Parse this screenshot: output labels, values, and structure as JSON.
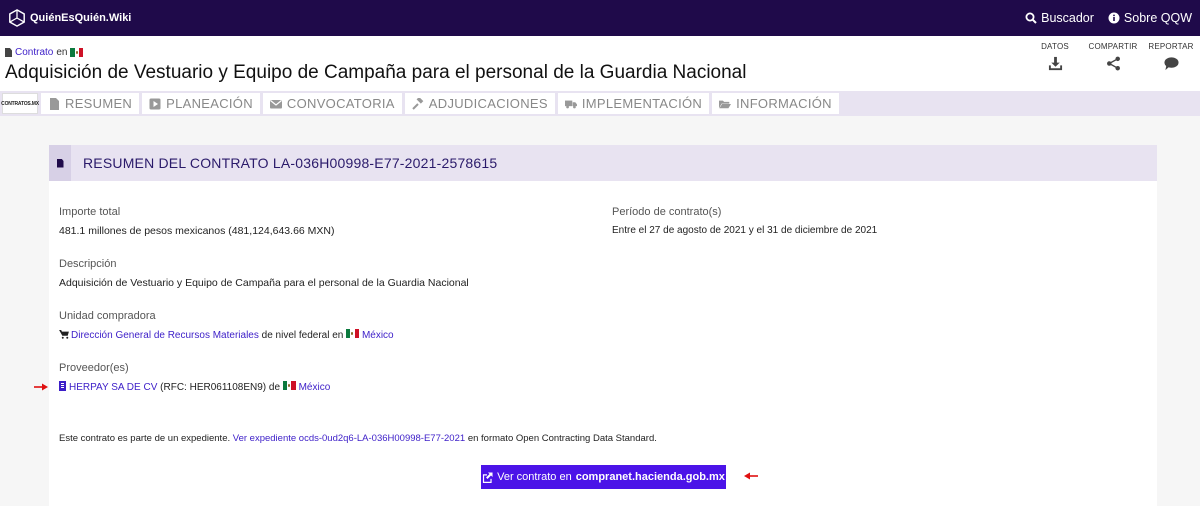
{
  "topbar": {
    "brand": "QuiénEsQuién.Wiki",
    "nav": [
      {
        "label": "Buscador",
        "icon": "search-icon"
      },
      {
        "label": "Sobre QQW",
        "icon": "info-icon"
      }
    ]
  },
  "header": {
    "breadcrumb_link": "Contrato",
    "breadcrumb_suffix": "en",
    "title": "Adquisición de Vestuario y Equipo de Campaña para el personal de la Guardia Nacional",
    "actions": [
      {
        "label": "DATOS",
        "icon": "download-icon"
      },
      {
        "label": "COMPARTIR",
        "icon": "share-icon"
      },
      {
        "label": "REPORTAR",
        "icon": "comment-icon"
      }
    ]
  },
  "tabs": {
    "logo": "CONTRATOS.MX",
    "items": [
      {
        "label": "RESUMEN",
        "icon": "file-icon"
      },
      {
        "label": "PLANEACIÓN",
        "icon": "play-icon"
      },
      {
        "label": "CONVOCATORIA",
        "icon": "envelope-icon"
      },
      {
        "label": "ADJUDICACIONES",
        "icon": "gavel-icon"
      },
      {
        "label": "IMPLEMENTACIÓN",
        "icon": "truck-icon"
      },
      {
        "label": "INFORMACIÓN",
        "icon": "folder-icon"
      }
    ]
  },
  "summary": {
    "heading": "RESUMEN DEL CONTRATO LA-036H00998-E77-2021-2578615",
    "importe_label": "Importe total",
    "importe_value": "481.1 millones de pesos mexicanos (481,124,643.66 MXN)",
    "periodo_label": "Período de contrato(s)",
    "periodo_value": "Entre el 27 de agosto de 2021 y el 31 de diciembre de 2021",
    "descripcion_label": "Descripción",
    "descripcion_value": "Adquisición de Vestuario y Equipo de Campaña para el personal de la Guardia Nacional",
    "unidad_label": "Unidad compradora",
    "unidad_link": "Dirección General de Recursos Materiales",
    "unidad_middle": "de nivel federal en",
    "unidad_country": "México",
    "proveedor_label": "Proveedor(es)",
    "proveedor_link": "HERPAY SA DE CV",
    "proveedor_rfc": "(RFC: HER061108EN9) de",
    "proveedor_country": "México",
    "expediente_prefix": "Este contrato es parte de un expediente.",
    "expediente_link": "Ver expediente ocds-0ud2q6-LA-036H00998-E77-2021",
    "expediente_suffix": "en formato Open Contracting Data Standard.",
    "button_prefix": "Ver contrato en",
    "button_bold": "compranet.hacienda.gob.mx"
  },
  "colors": {
    "topbar": "#1f0a4a",
    "accent": "#4b13e8",
    "link": "#3c1ec8",
    "tabs_bg": "#e8e3f1",
    "annotation_arrow": "#e01010"
  }
}
